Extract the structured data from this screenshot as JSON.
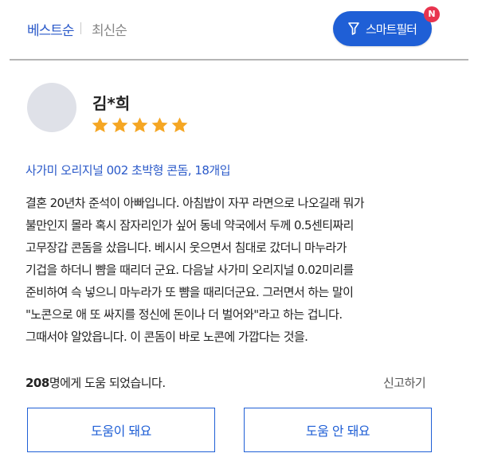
{
  "sort": {
    "best_label": "베스트순",
    "newest_label": "최신순"
  },
  "filter": {
    "label": "스마트필터",
    "badge": "N"
  },
  "review": {
    "reviewer_name": "김*희",
    "rating": 5,
    "rating_max": 5,
    "product_name": "사가미 오리지널 002 초박형 콘돔, 18개입",
    "body_lines": [
      "결혼 20년차 준석이 아빠입니다.  아침밥이 자꾸 라면으로 나오길래 뭐가",
      "불만인지 몰라  혹시 잠자리인가 싶어 동네  약국에서 두께 0.5센티짜리",
      "고무장갑 콘돔을 샀읍니다. 베시시 웃으면서 침대로 갔더니 마누라가",
      "기겁을 하더니 뺨을 때리더 군요. 다음날 사가미 오리지널 0.02미리를",
      "준비하여 슥 넣으니 마누라가 또 뺨을 때리더군요. 그러면서 하는 말이",
      "\"노콘으로 애 또 싸지를 정신에 돈이나 더 벌어와\"라고 하는 겁니다.",
      "그때서야 알았읍니다. 이 콘돔이 바로 노콘에 가깝다는 것을."
    ],
    "helpful_count": "208",
    "helpful_suffix": "명에게 도움 되었습니다.",
    "report_label": "신고하기",
    "helpful_button": "도움이 돼요",
    "not_helpful_button": "도움 안 돼요"
  },
  "colors": {
    "accent": "#1f5fd6",
    "star": "#f5a623",
    "badge": "#e8344e"
  },
  "icons": {
    "filter": "funnel-icon",
    "rating": "star-icon"
  }
}
